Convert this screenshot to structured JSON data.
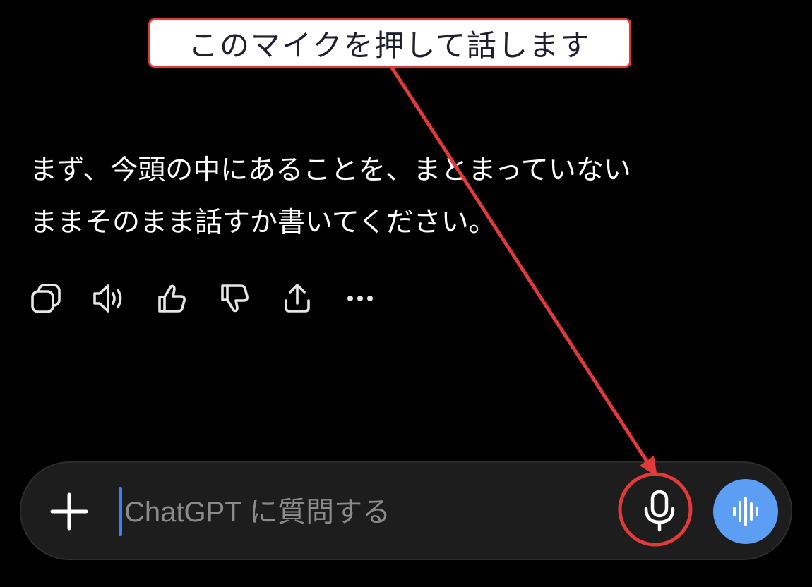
{
  "annotation": {
    "callout_text": "このマイクを押して話します",
    "color": "#e03a3a"
  },
  "message": {
    "lines": [
      "まず、今頭の中にあることを、まとまっていない",
      "ままそのまま話すか書いてください。"
    ],
    "actions": [
      {
        "icon": "copy-icon"
      },
      {
        "icon": "speaker-icon"
      },
      {
        "icon": "thumbs-up-icon"
      },
      {
        "icon": "thumbs-down-icon"
      },
      {
        "icon": "share-icon"
      },
      {
        "icon": "more-icon"
      }
    ]
  },
  "composer": {
    "placeholder": "ChatGPT に質問する",
    "plus_icon": "plus-icon",
    "mic_icon": "microphone-icon",
    "voice_icon": "voice-waveform-icon",
    "accent_color": "#5b9ef4",
    "caret_color": "#3b82f6"
  }
}
